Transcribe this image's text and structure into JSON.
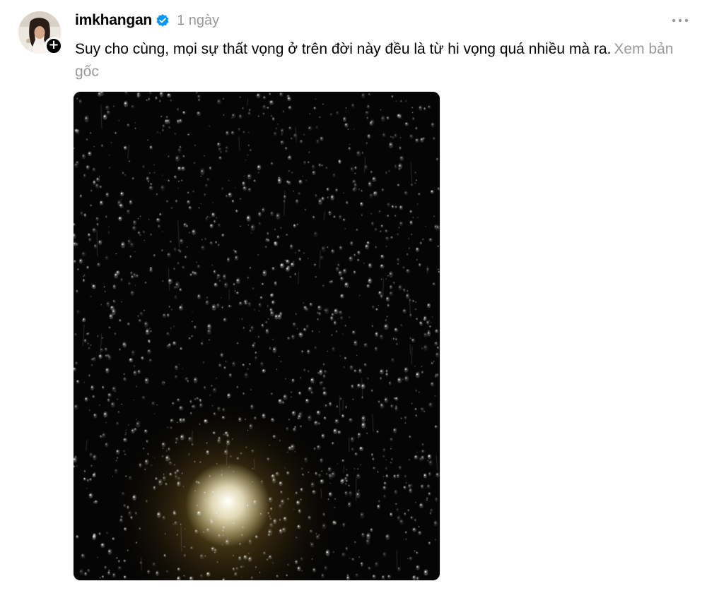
{
  "post": {
    "author": {
      "username": "imkhangan",
      "verified": true
    },
    "timestamp": "1 ngày",
    "text": "Suy cho cùng, mọi sự thất vọng ở trên đời này đều là từ hi vọng quá nhiều mà ra.",
    "see_original_label": "Xem bản gốc",
    "media": {
      "type": "image",
      "subject": "raindrops-on-window-at-night"
    }
  },
  "icons": {
    "verified": "verified-badge-icon",
    "follow": "plus-icon",
    "more": "more-horizontal-icon"
  },
  "colors": {
    "text": "#000000",
    "muted": "#999999",
    "verified_blue": "#0095f6",
    "background": "#ffffff"
  }
}
